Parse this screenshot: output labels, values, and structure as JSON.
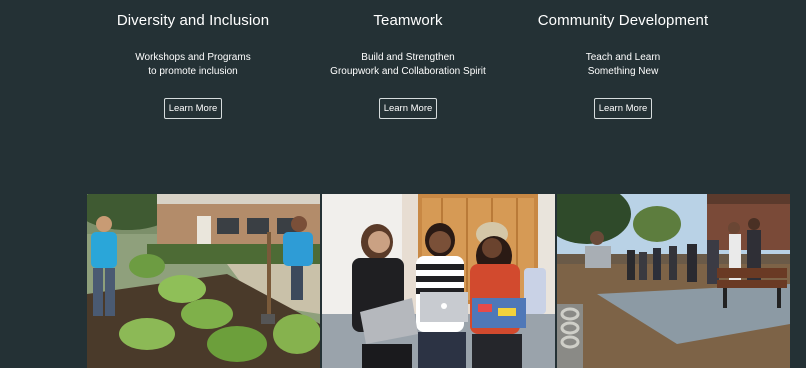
{
  "features": [
    {
      "title": "Diversity and Inclusion",
      "line1": "Workshops and Programs",
      "line2": "to promote inclusion",
      "button": "Learn More"
    },
    {
      "title": "Teamwork",
      "line1": "Build and Strengthen",
      "line2": "Groupwork and Collaboration Spirit",
      "button": "Learn More"
    },
    {
      "title": "Community Development",
      "line1": "Teach and Learn",
      "line2": "Something New",
      "button": "Learn More"
    }
  ],
  "colors": {
    "background": "#243135",
    "text": "#ffffff",
    "button_border": "#d6dcdd"
  }
}
